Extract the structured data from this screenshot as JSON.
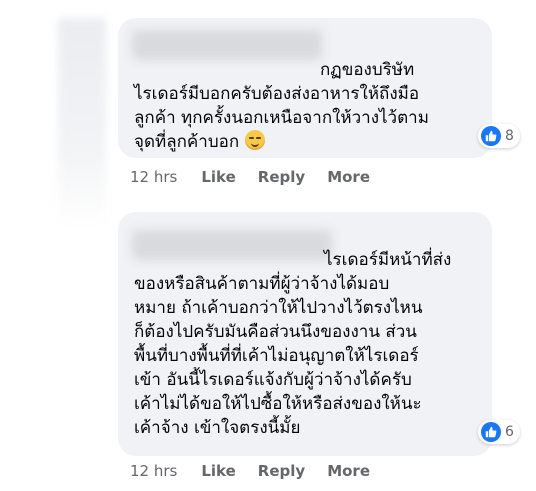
{
  "comments": [
    {
      "lines": [
        "กฏของบริษัท",
        "ไรเดอร์มีบอกครับต้องส่งอาหารให้ถึงมือ",
        "ลูกค้า ทุกครั้งนอกเหนือจากให้วางไว้ตาม",
        "จุดที่ลูกค้าบอก"
      ],
      "emoji": "smirking-face",
      "reaction_count": "8",
      "time": "12 hrs",
      "actions": {
        "like": "Like",
        "reply": "Reply",
        "more": "More"
      }
    },
    {
      "lines": [
        "ไรเดอร์มีหน้าที่ส่ง",
        "ของหรือสินค้าตามที่ผู้ว่าจ้างได้มอบ",
        "หมาย ถ้าเค้าบอกว่าให้ไปวางไว้ตรงไหน",
        "ก็ต้องไปครับมันคือส่วนนึงของงาน ส่วน",
        "พื้นที่บางพื้นที่ที่เค้าไม่อนุญาตให้ไรเดอร์",
        "เข้า อันนี้ไรเดอร์แจ้งกับผู้ว่าจ้างได้ครับ",
        "เค้าไม่ได้ขอให้ไปซื้อให้หรือส่งของให้นะ",
        "เค้าจ้าง เข้าใจตรงนี้มั้ย"
      ],
      "reaction_count": "6",
      "time": "12 hrs",
      "actions": {
        "like": "Like",
        "reply": "Reply",
        "more": "More"
      }
    }
  ],
  "colors": {
    "bubble": "#f0f2f5",
    "like_blue": "#1877f2",
    "meta_gray": "#65676b"
  }
}
